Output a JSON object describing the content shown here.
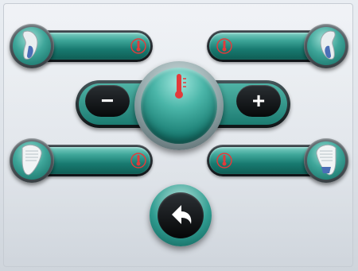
{
  "controls": {
    "minus_label": "−",
    "plus_label": "+"
  },
  "icons": {
    "temp_small": "thermometer-icon",
    "temp_main": "thermometer-icon",
    "tool_top": "tongue-cleaner-icon",
    "tool_bottom": "brush-head-icon",
    "back": "back-arrow-icon"
  },
  "colors": {
    "accent_teal": "#1c7b71",
    "alert_red": "#e23b3b",
    "dark": "#0b0e10"
  }
}
